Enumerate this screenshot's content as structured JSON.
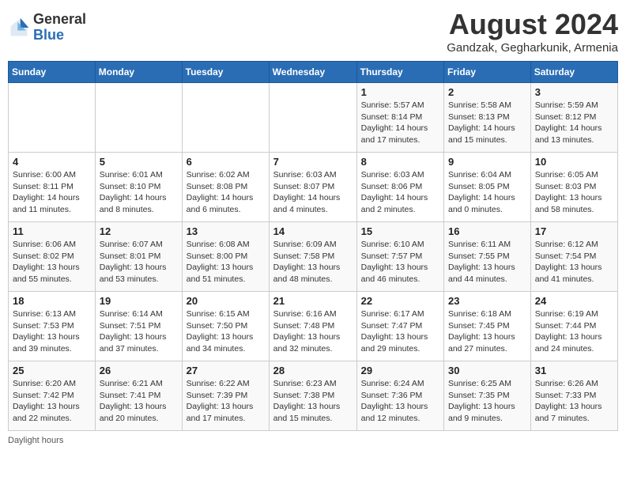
{
  "header": {
    "logo_general": "General",
    "logo_blue": "Blue",
    "month_title": "August 2024",
    "location": "Gandzak, Gegharkunik, Armenia"
  },
  "days_of_week": [
    "Sunday",
    "Monday",
    "Tuesday",
    "Wednesday",
    "Thursday",
    "Friday",
    "Saturday"
  ],
  "weeks": [
    [
      {
        "day": "",
        "info": ""
      },
      {
        "day": "",
        "info": ""
      },
      {
        "day": "",
        "info": ""
      },
      {
        "day": "",
        "info": ""
      },
      {
        "day": "1",
        "info": "Sunrise: 5:57 AM\nSunset: 8:14 PM\nDaylight: 14 hours and 17 minutes."
      },
      {
        "day": "2",
        "info": "Sunrise: 5:58 AM\nSunset: 8:13 PM\nDaylight: 14 hours and 15 minutes."
      },
      {
        "day": "3",
        "info": "Sunrise: 5:59 AM\nSunset: 8:12 PM\nDaylight: 14 hours and 13 minutes."
      }
    ],
    [
      {
        "day": "4",
        "info": "Sunrise: 6:00 AM\nSunset: 8:11 PM\nDaylight: 14 hours and 11 minutes."
      },
      {
        "day": "5",
        "info": "Sunrise: 6:01 AM\nSunset: 8:10 PM\nDaylight: 14 hours and 8 minutes."
      },
      {
        "day": "6",
        "info": "Sunrise: 6:02 AM\nSunset: 8:08 PM\nDaylight: 14 hours and 6 minutes."
      },
      {
        "day": "7",
        "info": "Sunrise: 6:03 AM\nSunset: 8:07 PM\nDaylight: 14 hours and 4 minutes."
      },
      {
        "day": "8",
        "info": "Sunrise: 6:03 AM\nSunset: 8:06 PM\nDaylight: 14 hours and 2 minutes."
      },
      {
        "day": "9",
        "info": "Sunrise: 6:04 AM\nSunset: 8:05 PM\nDaylight: 14 hours and 0 minutes."
      },
      {
        "day": "10",
        "info": "Sunrise: 6:05 AM\nSunset: 8:03 PM\nDaylight: 13 hours and 58 minutes."
      }
    ],
    [
      {
        "day": "11",
        "info": "Sunrise: 6:06 AM\nSunset: 8:02 PM\nDaylight: 13 hours and 55 minutes."
      },
      {
        "day": "12",
        "info": "Sunrise: 6:07 AM\nSunset: 8:01 PM\nDaylight: 13 hours and 53 minutes."
      },
      {
        "day": "13",
        "info": "Sunrise: 6:08 AM\nSunset: 8:00 PM\nDaylight: 13 hours and 51 minutes."
      },
      {
        "day": "14",
        "info": "Sunrise: 6:09 AM\nSunset: 7:58 PM\nDaylight: 13 hours and 48 minutes."
      },
      {
        "day": "15",
        "info": "Sunrise: 6:10 AM\nSunset: 7:57 PM\nDaylight: 13 hours and 46 minutes."
      },
      {
        "day": "16",
        "info": "Sunrise: 6:11 AM\nSunset: 7:55 PM\nDaylight: 13 hours and 44 minutes."
      },
      {
        "day": "17",
        "info": "Sunrise: 6:12 AM\nSunset: 7:54 PM\nDaylight: 13 hours and 41 minutes."
      }
    ],
    [
      {
        "day": "18",
        "info": "Sunrise: 6:13 AM\nSunset: 7:53 PM\nDaylight: 13 hours and 39 minutes."
      },
      {
        "day": "19",
        "info": "Sunrise: 6:14 AM\nSunset: 7:51 PM\nDaylight: 13 hours and 37 minutes."
      },
      {
        "day": "20",
        "info": "Sunrise: 6:15 AM\nSunset: 7:50 PM\nDaylight: 13 hours and 34 minutes."
      },
      {
        "day": "21",
        "info": "Sunrise: 6:16 AM\nSunset: 7:48 PM\nDaylight: 13 hours and 32 minutes."
      },
      {
        "day": "22",
        "info": "Sunrise: 6:17 AM\nSunset: 7:47 PM\nDaylight: 13 hours and 29 minutes."
      },
      {
        "day": "23",
        "info": "Sunrise: 6:18 AM\nSunset: 7:45 PM\nDaylight: 13 hours and 27 minutes."
      },
      {
        "day": "24",
        "info": "Sunrise: 6:19 AM\nSunset: 7:44 PM\nDaylight: 13 hours and 24 minutes."
      }
    ],
    [
      {
        "day": "25",
        "info": "Sunrise: 6:20 AM\nSunset: 7:42 PM\nDaylight: 13 hours and 22 minutes."
      },
      {
        "day": "26",
        "info": "Sunrise: 6:21 AM\nSunset: 7:41 PM\nDaylight: 13 hours and 20 minutes."
      },
      {
        "day": "27",
        "info": "Sunrise: 6:22 AM\nSunset: 7:39 PM\nDaylight: 13 hours and 17 minutes."
      },
      {
        "day": "28",
        "info": "Sunrise: 6:23 AM\nSunset: 7:38 PM\nDaylight: 13 hours and 15 minutes."
      },
      {
        "day": "29",
        "info": "Sunrise: 6:24 AM\nSunset: 7:36 PM\nDaylight: 13 hours and 12 minutes."
      },
      {
        "day": "30",
        "info": "Sunrise: 6:25 AM\nSunset: 7:35 PM\nDaylight: 13 hours and 9 minutes."
      },
      {
        "day": "31",
        "info": "Sunrise: 6:26 AM\nSunset: 7:33 PM\nDaylight: 13 hours and 7 minutes."
      }
    ]
  ],
  "footer": {
    "note": "Daylight hours"
  }
}
